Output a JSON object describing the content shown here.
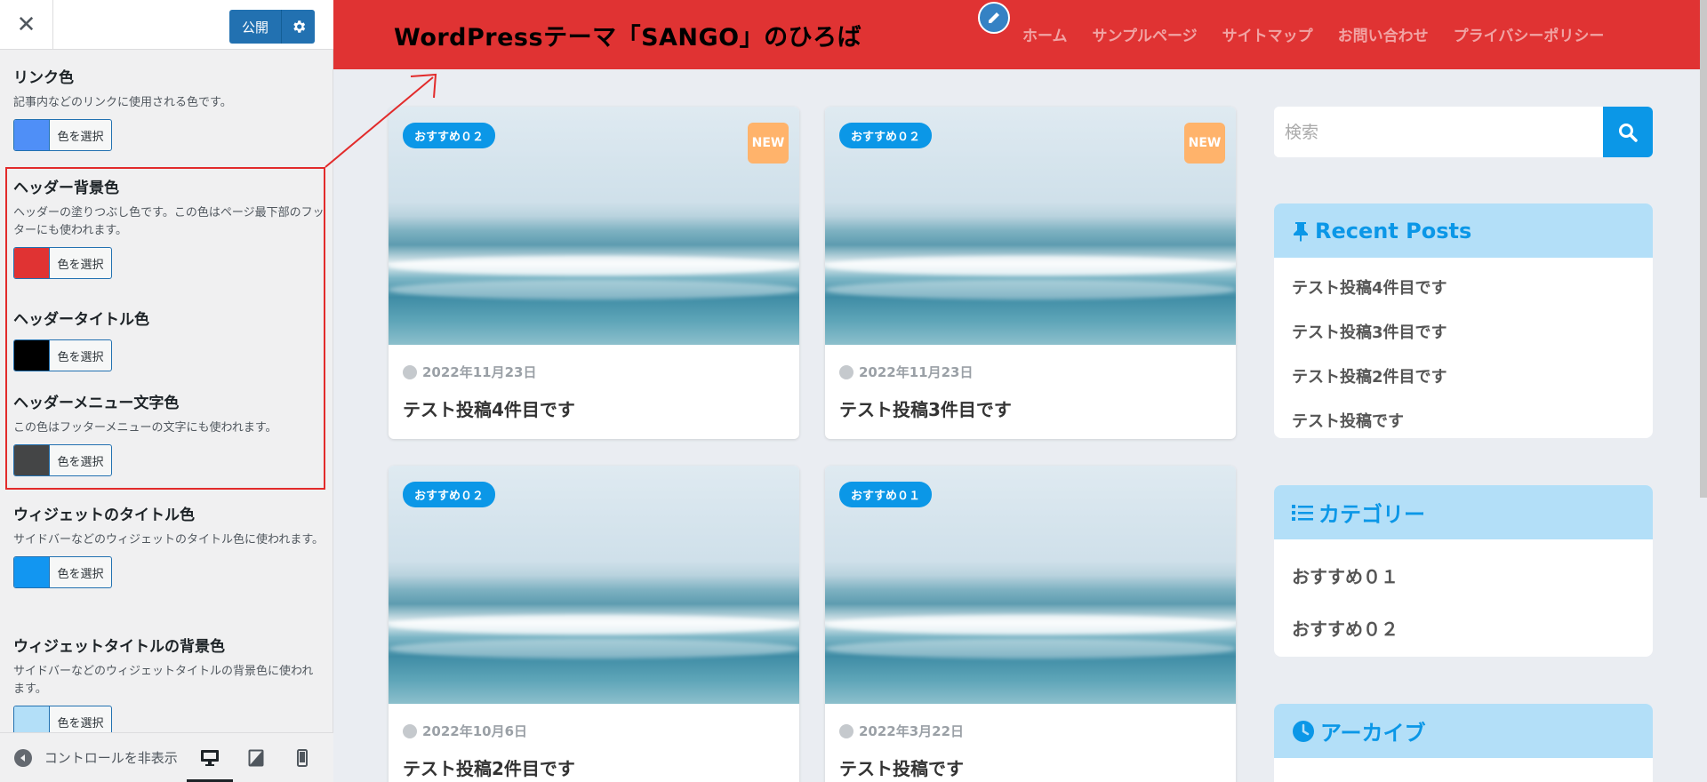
{
  "customizer": {
    "close_icon": "close-icon",
    "publish_label": "公開",
    "settings_icon": "gear-icon",
    "sections": [
      {
        "title": "リンク色",
        "desc": "記事内などのリンクに使用される色です。",
        "button": "色を選択",
        "color": "#4f8ff7"
      },
      {
        "title": "ヘッダー背景色",
        "desc": "ヘッダーの塗りつぶし色です。この色はページ最下部のフッターにも使われます。",
        "button": "色を選択",
        "color": "#e03333"
      },
      {
        "title": "ヘッダータイトル色",
        "desc": "",
        "button": "色を選択",
        "color": "#000000"
      },
      {
        "title": "ヘッダーメニュー文字色",
        "desc": "この色はフッターメニューの文字にも使われます。",
        "button": "色を選択",
        "color": "#444546"
      },
      {
        "title": "ウィジェットのタイトル色",
        "desc": "サイドバーなどのウィジェットのタイトル色に使われます。",
        "button": "色を選択",
        "color": "#1296f1"
      },
      {
        "title": "ウィジェットタイトルの背景色",
        "desc": "サイドバーなどのウィジェットタイトルの背景色に使われます。",
        "button": "色を選択",
        "color": "#b3dff8"
      }
    ],
    "footer": {
      "collapse_label": "コントロールを非表示",
      "devices": [
        "desktop-icon",
        "tablet-icon",
        "mobile-icon"
      ]
    }
  },
  "site": {
    "title": "WordPressテーマ「SANGO」のひろば",
    "header_color": "#e03333",
    "nav": [
      "ホーム",
      "サンプルページ",
      "サイトマップ",
      "お問い合わせ",
      "プライバシーポリシー"
    ],
    "posts": [
      {
        "category": "おすすめ０２",
        "new": "NEW",
        "date": "2022年11月23日",
        "title": "テスト投稿4件目です"
      },
      {
        "category": "おすすめ０２",
        "new": "NEW",
        "date": "2022年11月23日",
        "title": "テスト投稿3件目です"
      },
      {
        "category": "おすすめ０２",
        "new": "",
        "date": "2022年10月6日",
        "title": "テスト投稿2件目です"
      },
      {
        "category": "おすすめ０１",
        "new": "",
        "date": "2022年3月22日",
        "title": "テスト投稿です"
      }
    ],
    "search_placeholder": "検索",
    "widgets": {
      "recent": {
        "title": "Recent Posts",
        "items": [
          "テスト投稿4件目です",
          "テスト投稿3件目です",
          "テスト投稿2件目です",
          "テスト投稿です"
        ]
      },
      "categories": {
        "title": "カテゴリー",
        "items": [
          "おすすめ０１",
          "おすすめ０２"
        ]
      },
      "archive": {
        "title": "アーカイブ"
      }
    }
  }
}
